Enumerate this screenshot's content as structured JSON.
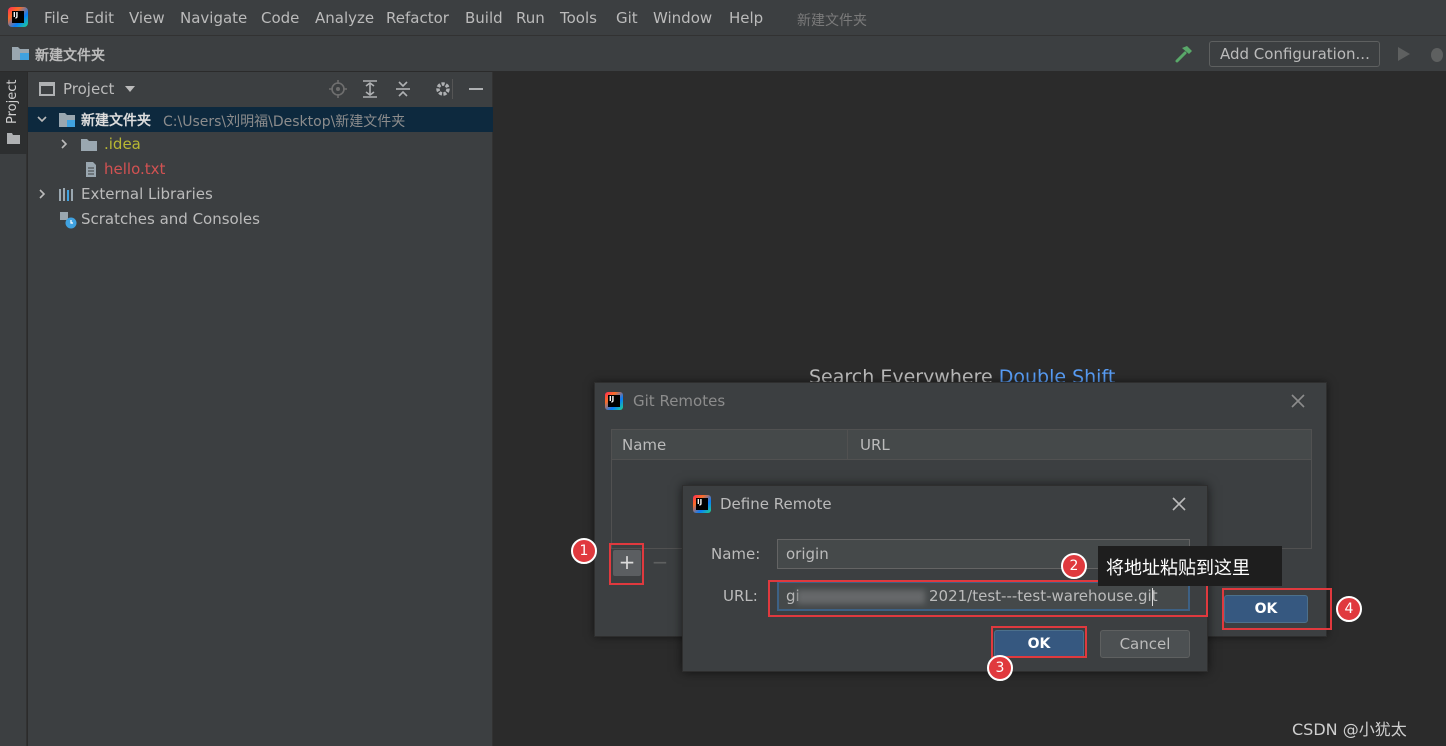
{
  "menu": {
    "items": [
      "File",
      "Edit",
      "View",
      "Navigate",
      "Code",
      "Analyze",
      "Refactor",
      "Build",
      "Run",
      "Tools",
      "Git",
      "Window",
      "Help"
    ],
    "project_title": "新建文件夹",
    "logo_text": "IJ"
  },
  "navbar": {
    "project_name": "新建文件夹",
    "add_configuration_label": "Add Configuration..."
  },
  "left_stripe": {
    "tab_label": "Project"
  },
  "project_panel": {
    "title": "Project",
    "tree": [
      {
        "label": "新建文件夹",
        "path": "C:\\Users\\刘明福\\Desktop\\新建文件夹",
        "type": "module",
        "expanded": true,
        "selected": true
      },
      {
        "label": ".idea",
        "type": "folder",
        "expanded": false,
        "color": "#b8b833"
      },
      {
        "label": "hello.txt",
        "type": "file",
        "color": "#d25252"
      },
      {
        "label": "External Libraries",
        "type": "library",
        "expanded": false
      },
      {
        "label": "Scratches and Consoles",
        "type": "scratches"
      }
    ]
  },
  "editor": {
    "search_hint_text": "Search Everywhere",
    "search_hint_shortcut": "Double Shift"
  },
  "git_remotes_dialog": {
    "title": "Git Remotes",
    "columns": [
      "Name",
      "URL"
    ],
    "add_label": "+",
    "remove_label": "−",
    "ok_label": "OK"
  },
  "define_remote_dialog": {
    "title": "Define Remote",
    "name_label": "Name:",
    "name_value": "origin",
    "url_label": "URL:",
    "url_value_prefix": "gi",
    "url_value_suffix": "2021/test---test-warehouse.git",
    "ok_label": "OK",
    "cancel_label": "Cancel"
  },
  "annotations": {
    "badges": [
      "1",
      "2",
      "3",
      "4"
    ],
    "tip": "将地址粘贴到这里",
    "color": "#e0393e"
  },
  "watermark": "CSDN @小犹太",
  "colors": {
    "accent_blue": "#589df6",
    "button_blue": "#365880",
    "selection": "#0d293e"
  }
}
